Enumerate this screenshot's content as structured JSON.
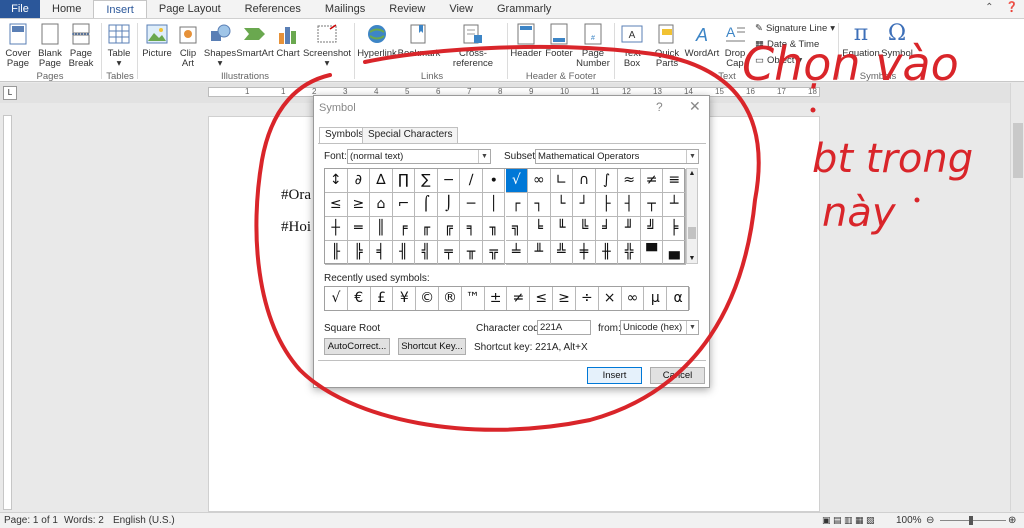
{
  "ribbon_tabs": [
    "File",
    "Home",
    "Insert",
    "Page Layout",
    "References",
    "Mailings",
    "Review",
    "View",
    "Grammarly"
  ],
  "active_tab": "Insert",
  "window_controls": {
    "help": "?",
    "restore": "⬜",
    "close": "✕"
  },
  "ribbon": {
    "pages": {
      "cover": "Cover",
      "cover2": "Page",
      "blank": "Blank",
      "blank2": "Page",
      "break": "Page",
      "break2": "Break",
      "group": "Pages"
    },
    "tables": {
      "table": "Table",
      "group": "Tables"
    },
    "illustrations": {
      "picture": "Picture",
      "clip": "Clip",
      "clip2": "Art",
      "shapes": "Shapes",
      "smartart": "SmartArt",
      "chart": "Chart",
      "screenshot": "Screenshot",
      "group": "Illustrations"
    },
    "links": {
      "hyperlink": "Hyperlink",
      "bookmark": "Bookmark",
      "crossref": "Cross-reference",
      "group": "Links"
    },
    "header_footer": {
      "header": "Header",
      "footer": "Footer",
      "page_number": "Page",
      "page_number2": "Number",
      "group": "Header & Footer"
    },
    "text": {
      "textbox": "Text",
      "textbox2": "Box",
      "quickparts": "Quick",
      "quickparts2": "Parts",
      "wordart": "WordArt",
      "dropcap": "Drop",
      "dropcap2": "Cap",
      "signature": "Signature Line",
      "datetime": "Date & Time",
      "object": "Object",
      "group": "Text"
    },
    "symbols": {
      "equation": "Equation",
      "symbol": "Symbol",
      "group": "Symbols"
    }
  },
  "ruler_numbers": [
    "1",
    "1",
    "2",
    "3",
    "4",
    "5",
    "6",
    "7",
    "8",
    "9",
    "10",
    "11",
    "12",
    "13",
    "14",
    "15",
    "16",
    "17",
    "18"
  ],
  "document": {
    "line1": "#Ora",
    "line2": "#Hoi"
  },
  "status": {
    "page": "Page: 1 of 1",
    "words": "Words: 2",
    "language": "English (U.S.)",
    "zoom": "100%"
  },
  "dialog": {
    "title": "Symbol",
    "help": "?",
    "close": "✕",
    "tabs": [
      "Symbols",
      "Special Characters"
    ],
    "font_label": "Font:",
    "font_value": "(normal text)",
    "subset_label": "Subset:",
    "subset_value": "Mathematical Operators",
    "symbols": [
      "↕",
      "∂",
      "∆",
      "∏",
      "∑",
      "−",
      "∕",
      "∙",
      "√",
      "∞",
      "∟",
      "∩",
      "∫",
      "≈",
      "≠",
      "≡",
      "≤",
      "≥",
      "⌂",
      "⌐",
      "⌠",
      "⌡",
      "─",
      "│",
      "┌",
      "┐",
      "└",
      "┘",
      "├",
      "┤",
      "┬",
      "┴",
      "┼",
      "═",
      "║",
      "╒",
      "╓",
      "╔",
      "╕",
      "╖",
      "╗",
      "╘",
      "╙",
      "╚",
      "╛",
      "╜",
      "╝",
      "╞",
      "╟",
      "╠",
      "╡",
      "╢",
      "╣",
      "╤",
      "╥",
      "╦",
      "╧",
      "╨",
      "╩",
      "╪",
      "╫",
      "╬",
      "▀",
      "▄"
    ],
    "selected_index": 8,
    "recent_label": "Recently used symbols:",
    "recent": [
      "√",
      "€",
      "£",
      "¥",
      "©",
      "®",
      "™",
      "±",
      "≠",
      "≤",
      "≥",
      "÷",
      "×",
      "∞",
      "µ",
      "α"
    ],
    "char_name": "Square Root",
    "char_code_label": "Character code:",
    "char_code": "221A",
    "from_label": "from:",
    "from_value": "Unicode (hex)",
    "autocorrect": "AutoCorrect...",
    "shortcut_key_btn": "Shortcut Key...",
    "shortcut_text": "Shortcut key: 221A, Alt+X",
    "insert": "Insert",
    "cancel": "Cancel"
  },
  "annotation": {
    "text1": "Chọn vào",
    "text2": "bt trong",
    "text3": "này",
    "color": "#d9252a"
  }
}
